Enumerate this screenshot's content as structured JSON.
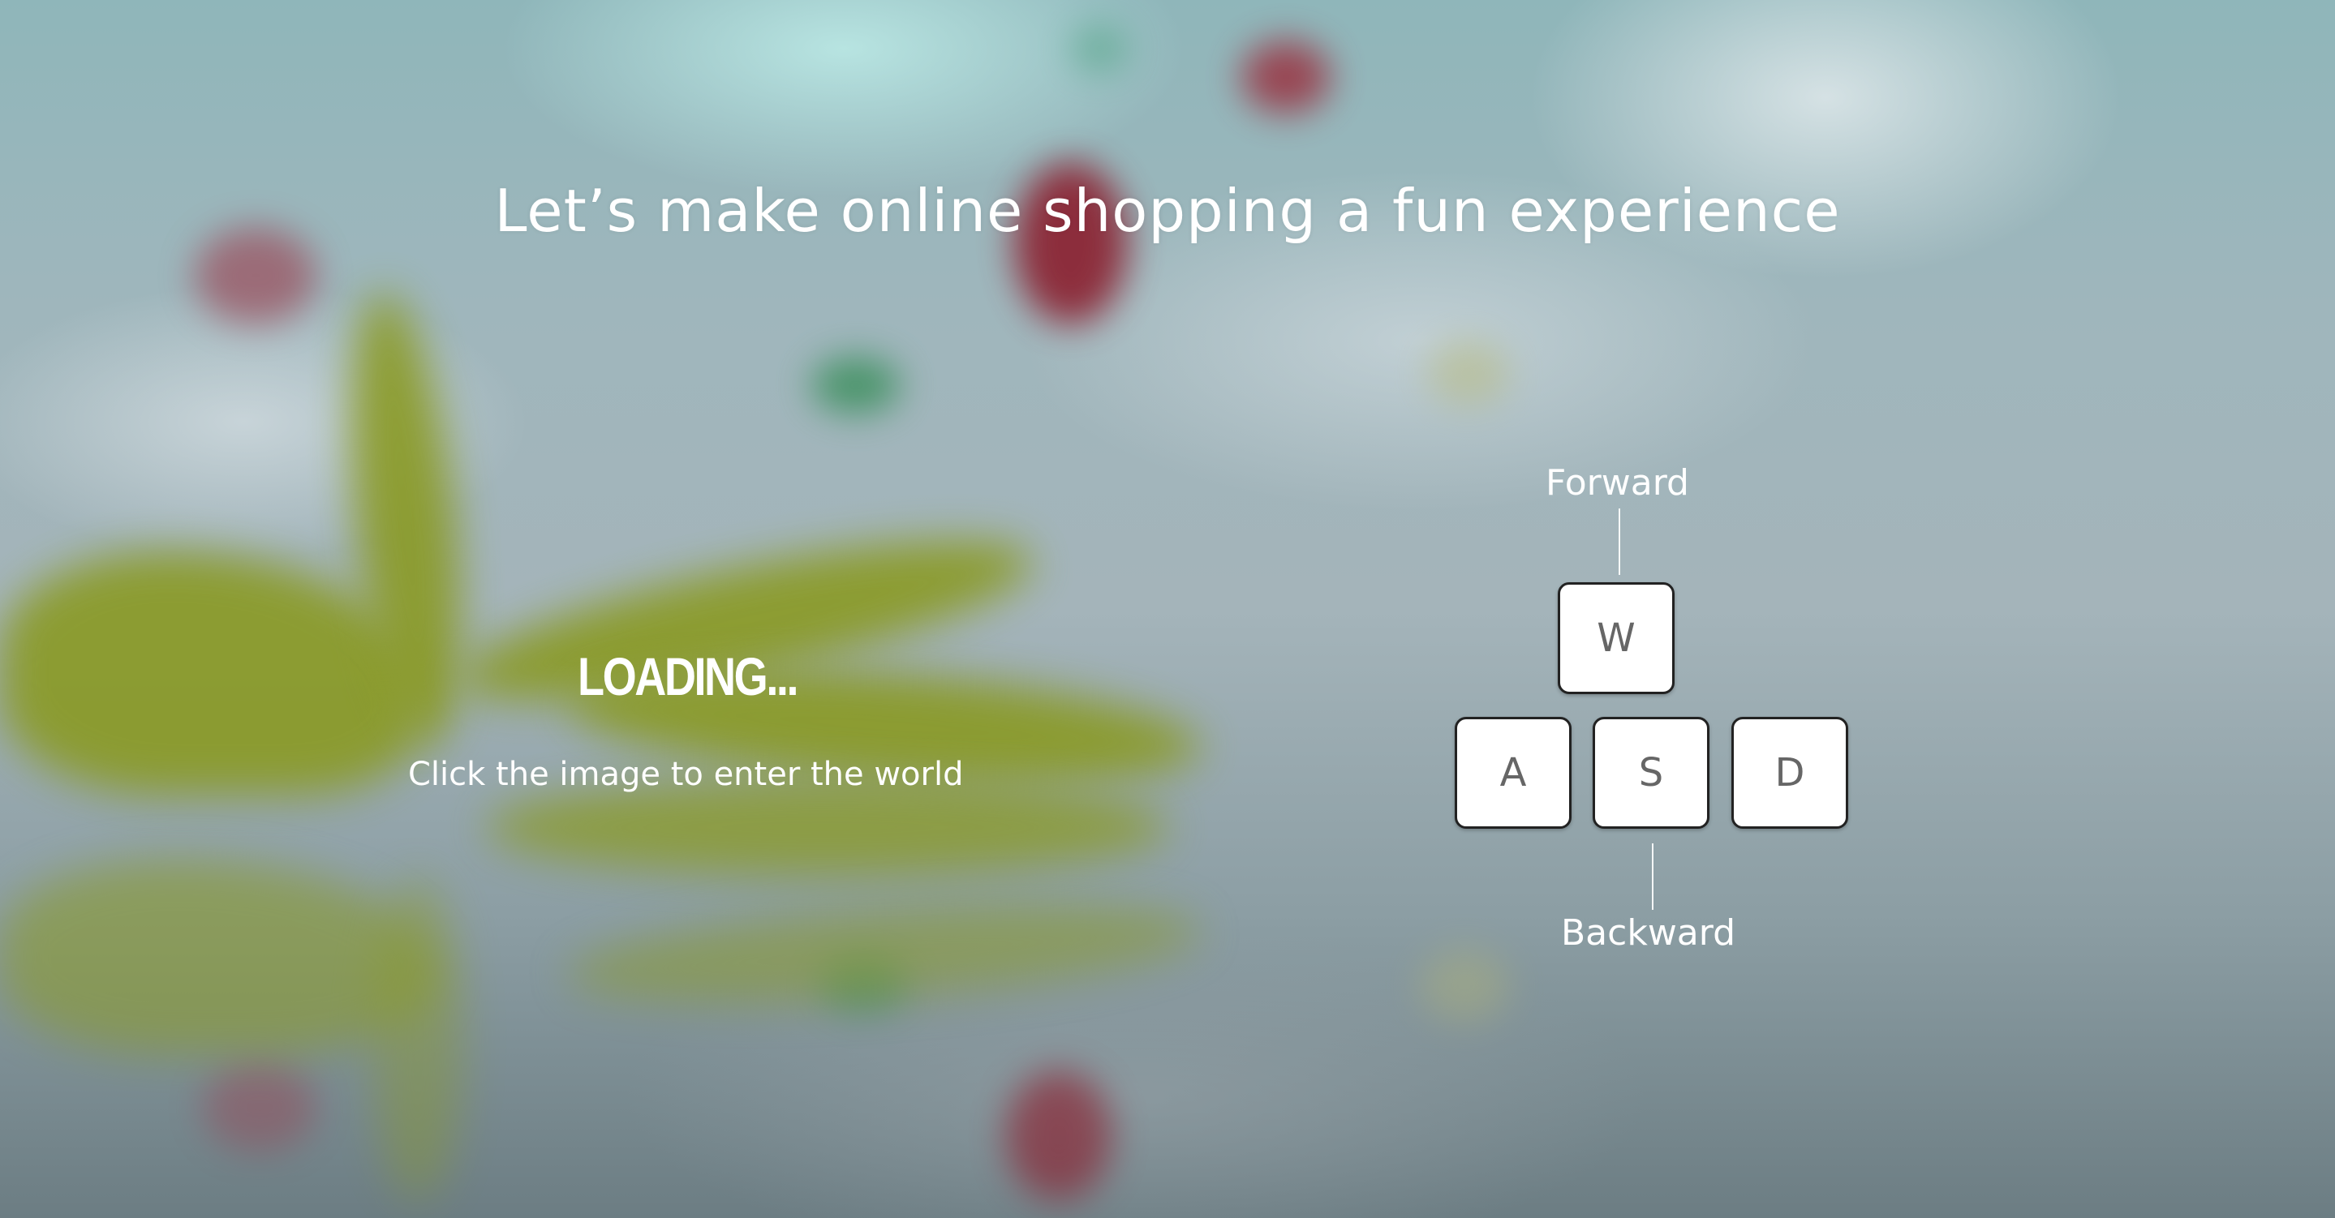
{
  "page": {
    "headline": "Let’s make online shopping a fun experience",
    "loading_text": "LOADING...",
    "hint": "Click the image to enter the world"
  },
  "controls": {
    "keys": {
      "w": "W",
      "a": "A",
      "s": "S",
      "d": "D"
    },
    "forward_label": "Forward",
    "backward_label": "Backward"
  },
  "colors": {
    "text": "#ffffff",
    "key_background": "#ffffff",
    "key_border": "#222222",
    "key_text": "#666666"
  }
}
